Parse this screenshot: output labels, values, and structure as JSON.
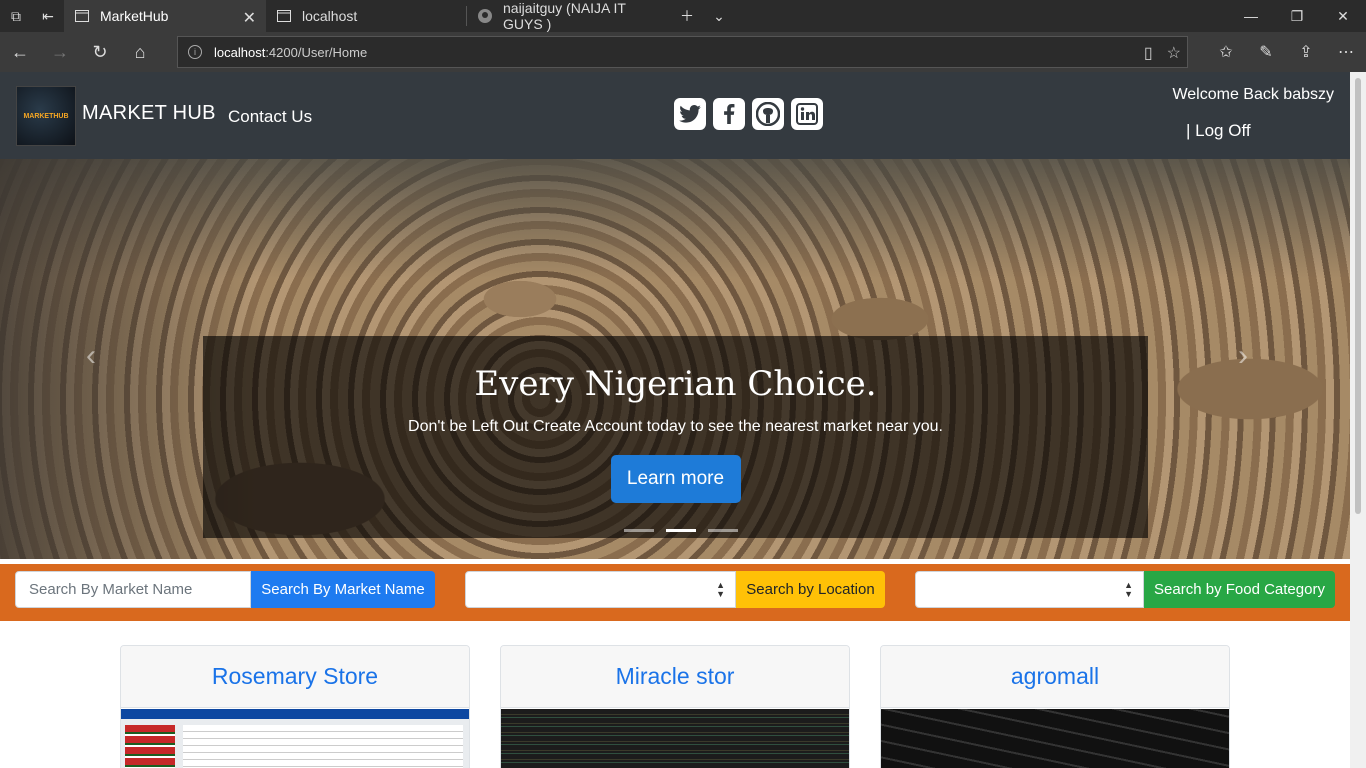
{
  "browser": {
    "tabs": [
      {
        "title": "MarketHub",
        "active": true
      },
      {
        "title": "localhost",
        "active": false
      },
      {
        "title": "naijaitguy (NAIJA IT GUYS )",
        "active": false
      }
    ],
    "url": {
      "host": "localhost",
      "rest": ":4200/User/Home"
    }
  },
  "navbar": {
    "brand": "MARKET HUB",
    "logo_text": "MARKETHUB",
    "contact": "Contact Us",
    "socials": [
      "twitter-icon",
      "facebook-icon",
      "github-icon",
      "linkedin-icon"
    ],
    "welcome": "Welcome Back babszy",
    "logoff": "| Log Off"
  },
  "carousel": {
    "title": "Every Nigerian Choice.",
    "text": "Don't be Left Out Create Account today to see the nearest market near you.",
    "button": "Learn more",
    "slides": 3,
    "active_slide": 2
  },
  "search": {
    "market_placeholder": "Search By Market Name",
    "market_button": "Search By Market Name",
    "location_button": "Search by Location",
    "category_button": "Search by Food Category",
    "colors": {
      "bar": "#d9691e",
      "market": "#1e7bf0",
      "location": "#ffc107",
      "category": "#28a745"
    }
  },
  "stores": [
    {
      "name": "Rosemary Store"
    },
    {
      "name": "Miracle stor"
    },
    {
      "name": "agromall"
    }
  ]
}
